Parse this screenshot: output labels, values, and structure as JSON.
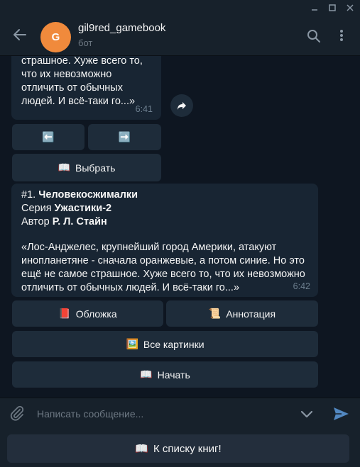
{
  "header": {
    "name": "gil9red_gamebook",
    "subtitle": "бот",
    "avatar_letter": "G"
  },
  "messages": {
    "first": {
      "lines": [
        "страшное. Хуже всего то,",
        "что их невозможно",
        "отличить от обычных",
        "людей. И всё-таки го...»"
      ],
      "time": "6:41"
    },
    "nav_prev": "⬅️",
    "nav_next": "➡️",
    "choose": "Выбрать",
    "choose_emoji": "📖",
    "second": {
      "title_prefix": "#1. ",
      "title": "Человекосжималки",
      "series_label": "Серия ",
      "series": "Ужастики-2",
      "author_label": "Автор ",
      "author": "Р. Л. Стайн",
      "desc_lines": [
        "«Лос-Анджелес, крупнейший город Америки, атакуют",
        "инопланетяне - сначала оранжевые, а потом синие. Но это",
        "ещё не самое страшное. Хуже всего то, что их невозможно",
        "отличить от обычных людей. И всё-таки го...»"
      ],
      "time": "6:42"
    },
    "buttons": {
      "cover": "Обложка",
      "cover_emoji": "📕",
      "annotation": "Аннотация",
      "annotation_emoji": "📜",
      "all_pictures": "Все картинки",
      "all_pictures_emoji": "🖼️",
      "start": "Начать",
      "start_emoji": "📖"
    }
  },
  "composer": {
    "placeholder": "Написать сообщение..."
  },
  "bottom_keyboard": {
    "label": "К списку книг!",
    "emoji": "📖"
  },
  "colors": {
    "background": "#0e1621",
    "panel": "#17212b",
    "bubble": "#182533",
    "button": "#1e2c3a",
    "accent": "#5288c1",
    "avatar": "#f08a3c"
  }
}
